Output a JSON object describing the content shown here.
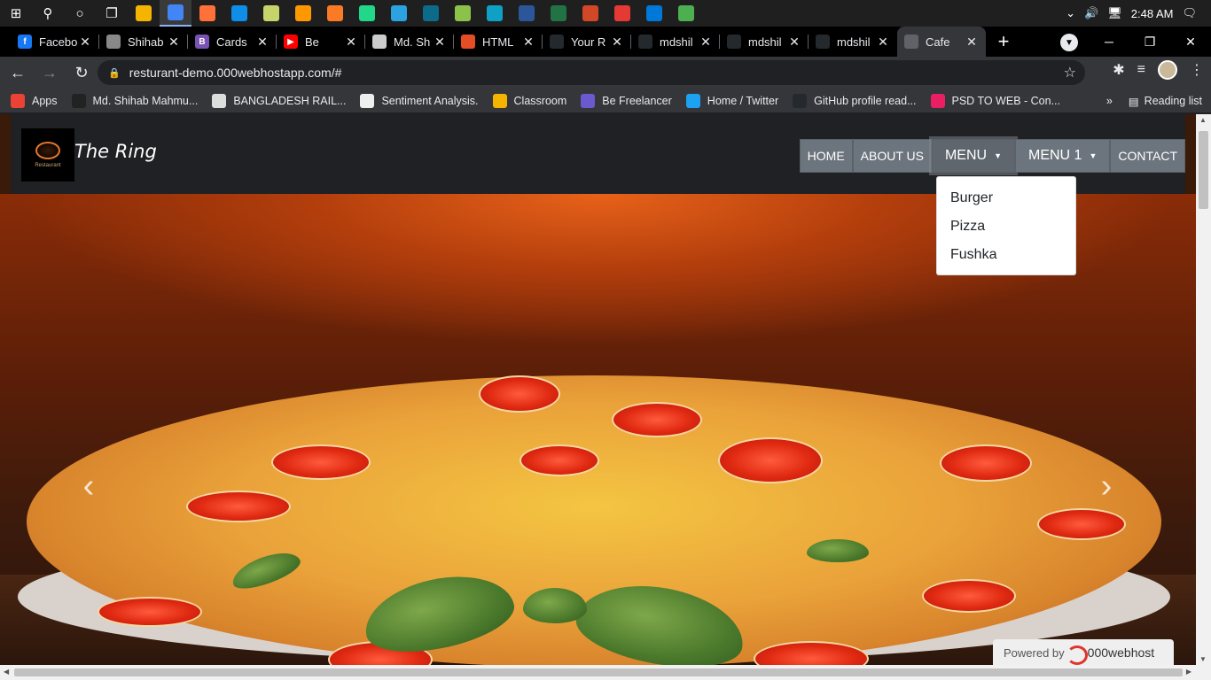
{
  "taskbar": {
    "apps": [
      {
        "icon": "file-explorer-icon",
        "color": "#f4b400"
      },
      {
        "icon": "chrome-icon",
        "color": "#4285f4"
      },
      {
        "icon": "firefox-icon",
        "color": "#ff7139"
      },
      {
        "icon": "teamviewer-icon",
        "color": "#0e8ee9"
      },
      {
        "icon": "notepad-icon",
        "color": "#c7d46a"
      },
      {
        "icon": "sublime-icon",
        "color": "#ff9800"
      },
      {
        "icon": "xampp-icon",
        "color": "#fb7a24"
      },
      {
        "icon": "pycharm-icon",
        "color": "#21d789"
      },
      {
        "icon": "telegram-icon",
        "color": "#2aa3e0"
      },
      {
        "icon": "vscode-blue-icon",
        "color": "#0c6a8a"
      },
      {
        "icon": "android-icon",
        "color": "#8bc34a"
      },
      {
        "icon": "edge-icon",
        "color": "#0fa0c6"
      },
      {
        "icon": "word-icon",
        "color": "#2b579a"
      },
      {
        "icon": "excel-icon",
        "color": "#217346"
      },
      {
        "icon": "powerpoint-icon",
        "color": "#d24726"
      },
      {
        "icon": "colorful-app-icon",
        "color": "#e53935"
      },
      {
        "icon": "vscode-icon",
        "color": "#0078d7"
      },
      {
        "icon": "loader-icon",
        "color": "#4caf50"
      }
    ],
    "time": "2:48 AM"
  },
  "tabs": [
    {
      "title": "Facebo",
      "fav_color": "#1877f2",
      "fav_text": "f"
    },
    {
      "title": "Shihab",
      "fav_color": "#888888",
      "fav_text": ""
    },
    {
      "title": "Cards",
      "fav_color": "#7952b3",
      "fav_text": "B"
    },
    {
      "title": "Be",
      "fav_color": "#ff0000",
      "fav_text": "▶"
    },
    {
      "title": "Md. Sh",
      "fav_color": "#cccccc",
      "fav_text": ""
    },
    {
      "title": "HTML",
      "fav_color": "#e44d26",
      "fav_text": ""
    },
    {
      "title": "Your R",
      "fav_color": "#24292e",
      "fav_text": ""
    },
    {
      "title": "mdshil",
      "fav_color": "#24292e",
      "fav_text": ""
    },
    {
      "title": "mdshil",
      "fav_color": "#24292e",
      "fav_text": ""
    },
    {
      "title": "mdshil",
      "fav_color": "#24292e",
      "fav_text": ""
    },
    {
      "title": "Cafe",
      "fav_color": "#5f6368",
      "fav_text": ""
    }
  ],
  "address": {
    "url": "resturant-demo.000webhostapp.com/#"
  },
  "bookmarks": [
    {
      "label": "Apps",
      "color": "#ea4335"
    },
    {
      "label": "Md. Shihab Mahmu...",
      "color": "#222222"
    },
    {
      "label": "BANGLADESH RAIL...",
      "color": "#dddddd"
    },
    {
      "label": "Sentiment Analysis.",
      "color": "#eeeeee"
    },
    {
      "label": "Classroom",
      "color": "#f4b400"
    },
    {
      "label": "Be Freelancer",
      "color": "#6a5acd"
    },
    {
      "label": "Home / Twitter",
      "color": "#1da1f2"
    },
    {
      "label": "GitHub profile read...",
      "color": "#24292e"
    },
    {
      "label": "PSD TO WEB - Con...",
      "color": "#e91e63"
    }
  ],
  "reading_list": "Reading list",
  "site": {
    "brand": "The Ring",
    "logo_text": "Restaurant",
    "nav": {
      "home": "HOME",
      "about": "ABOUT US",
      "menu": "MENU",
      "menu1": "MENU 1",
      "contact": "CONTACT"
    },
    "dropdown": [
      "Burger",
      "Pizza",
      "Fushka"
    ],
    "powered_by": "Powered by",
    "host": "000webhost"
  }
}
